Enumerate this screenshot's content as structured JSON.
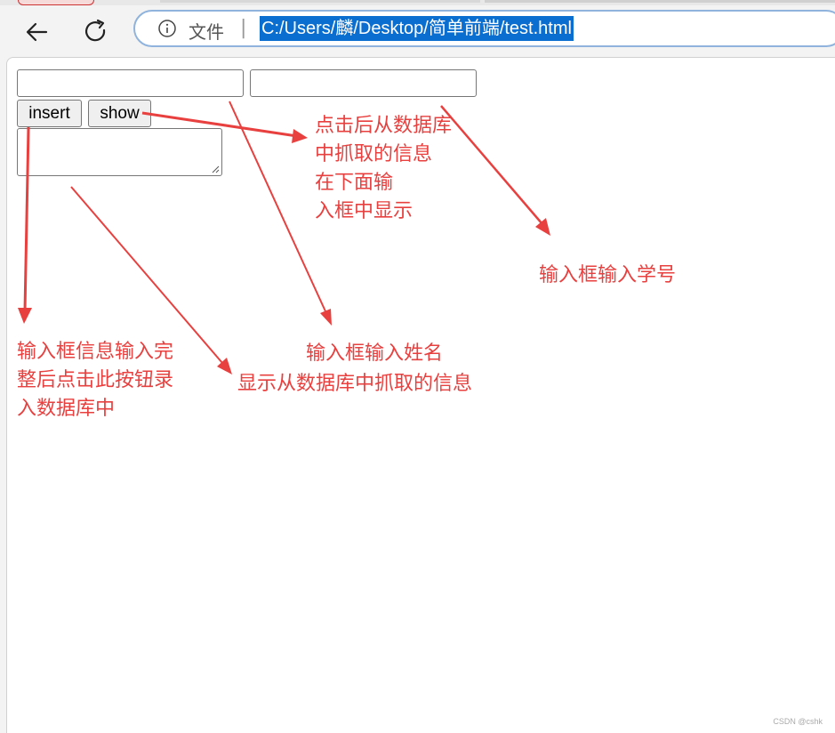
{
  "browser": {
    "scheme_label": "文件",
    "separator": "|",
    "url": "C:/Users/麟/Desktop/简单前端/test.html",
    "icons": [
      "back-arrow-icon",
      "reload-icon",
      "info-icon"
    ]
  },
  "page": {
    "buttons": {
      "insert_label": "insert",
      "show_label": "show"
    },
    "fields": {
      "name_value": "",
      "id_value": "",
      "textarea_value": ""
    }
  },
  "annotations": {
    "show_note": "点击后从数据库\n中抓取的信息\n在下面输\n入框中显示",
    "id_note": "输入框输入学号",
    "name_note": "输入框输入姓名",
    "textarea_note": "显示从数据库中抓取的信息",
    "insert_note": "输入框信息输入完\n整后点击此按钮录\n入数据库中",
    "color": "#e8403f"
  },
  "watermark": "CSDN @cshk"
}
